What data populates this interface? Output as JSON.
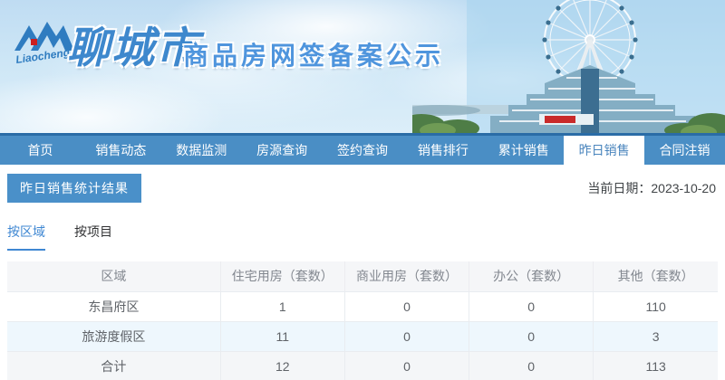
{
  "banner": {
    "logo_script": "Liaocheng",
    "city_name": "聊城市",
    "site_title": "商品房网签备案公示"
  },
  "nav": {
    "items": [
      {
        "label": "首页",
        "active": false
      },
      {
        "label": "销售动态",
        "active": false
      },
      {
        "label": "数据监测",
        "active": false
      },
      {
        "label": "房源查询",
        "active": false
      },
      {
        "label": "签约查询",
        "active": false
      },
      {
        "label": "销售排行",
        "active": false
      },
      {
        "label": "累计销售",
        "active": false
      },
      {
        "label": "昨日销售",
        "active": true
      },
      {
        "label": "合同注销",
        "active": false
      }
    ]
  },
  "page": {
    "section_title": "昨日销售统计结果",
    "date_label": "当前日期：",
    "date_value": "2023-10-20"
  },
  "tabs": [
    {
      "label": "按区域",
      "active": true
    },
    {
      "label": "按项目",
      "active": false
    }
  ],
  "table": {
    "headers": [
      "区域",
      "住宅用房（套数）",
      "商业用房（套数）",
      "办公（套数）",
      "其他（套数）"
    ],
    "rows": [
      {
        "region": "东昌府区",
        "values": [
          "1",
          "0",
          "0",
          "110"
        ],
        "stripe": ""
      },
      {
        "region": "旅游度假区",
        "values": [
          "11",
          "0",
          "0",
          "3"
        ],
        "stripe": "stripe-blue"
      },
      {
        "region": "合计",
        "values": [
          "12",
          "0",
          "0",
          "113"
        ],
        "stripe": "stripe-gray"
      }
    ]
  },
  "colors": {
    "nav-blue": "#4a8ec5",
    "nav-line": "#2a6ca6",
    "badge-blue": "#4a90c9",
    "tab-active": "#3f87d2"
  }
}
